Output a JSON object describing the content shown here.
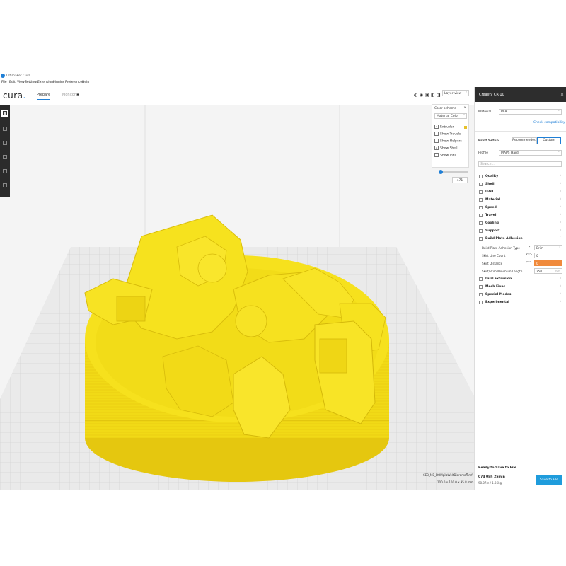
{
  "window": {
    "title": "Ultimaker Cura"
  },
  "menu": [
    "File",
    "Edit",
    "View",
    "Settings",
    "Extensions",
    "Plugins",
    "Preferences",
    "Help"
  ],
  "header": {
    "logo_text": "cura",
    "logo_dot": ".",
    "tab_prepare": "Prepare",
    "tab_monitor": "Monitor",
    "view_type": "Layer view"
  },
  "color_panel": {
    "title": "Color scheme",
    "close": "×",
    "scheme": "Material Color",
    "options": [
      {
        "label": "Extruder",
        "checked": true
      },
      {
        "label": "Show Travels",
        "checked": false
      },
      {
        "label": "Show Helpers",
        "checked": false
      },
      {
        "label": "Show Shell",
        "checked": true
      },
      {
        "label": "Show Infill",
        "checked": false
      }
    ]
  },
  "layer": {
    "current": "471"
  },
  "object_info": {
    "name": "CE3_MB_DOMpilzWeltDiorama.3mf",
    "dimensions": "100.0 x 100.0 x 95.8 mm"
  },
  "panel": {
    "title": "Creality CR-10",
    "close": "×",
    "material_label": "Material",
    "material_value": "PLA",
    "check_compat": "Check compatibility",
    "print_setup": "Print Setup",
    "recommended": "Recommended",
    "custom": "Custom",
    "profile_label": "Profile",
    "profile_value": "MAPS Hard",
    "search_placeholder": "Search...",
    "categories": [
      {
        "label": "Quality",
        "chev": "‹"
      },
      {
        "label": "Shell",
        "chev": "‹"
      },
      {
        "label": "Infill",
        "chev": "‹"
      },
      {
        "label": "Material",
        "chev": "‹"
      },
      {
        "label": "Speed",
        "chev": "‹"
      },
      {
        "label": "Travel",
        "chev": "‹"
      },
      {
        "label": "Cooling",
        "chev": "‹"
      },
      {
        "label": "Support",
        "chev": "‹"
      },
      {
        "label": "Build Plate Adhesion",
        "chev": "˅"
      }
    ],
    "adhesion_rows": [
      {
        "label": "Build Plate Adhesion Type",
        "value": "Brim",
        "icons": "↶",
        "unit": "˅",
        "error": false
      },
      {
        "label": "Skirt Line Count",
        "value": "0",
        "icons": "↶ ↷",
        "unit": "",
        "error": false
      },
      {
        "label": "Skirt Distance",
        "value": "0",
        "icons": "↶ ↷",
        "unit": "",
        "error": true
      },
      {
        "label": "Skirt/Brim Minimum Length",
        "value": "250",
        "icons": "",
        "unit": "mm",
        "error": false
      }
    ],
    "more_categories": [
      {
        "label": "Dual Extrusion",
        "chev": "‹"
      },
      {
        "label": "Mesh Fixes",
        "chev": "‹"
      },
      {
        "label": "Special Modes",
        "chev": "‹"
      },
      {
        "label": "Experimental",
        "chev": "‹"
      }
    ],
    "ready": "Ready to Save to File",
    "estimate_time": "07d 08h 25min",
    "estimate_material": "98.07m / 1.36kg",
    "save_button": "Save to File"
  },
  "colors": {
    "accent": "#1f7fd6",
    "model": "#f5e01c",
    "error": "#f08a3c"
  }
}
